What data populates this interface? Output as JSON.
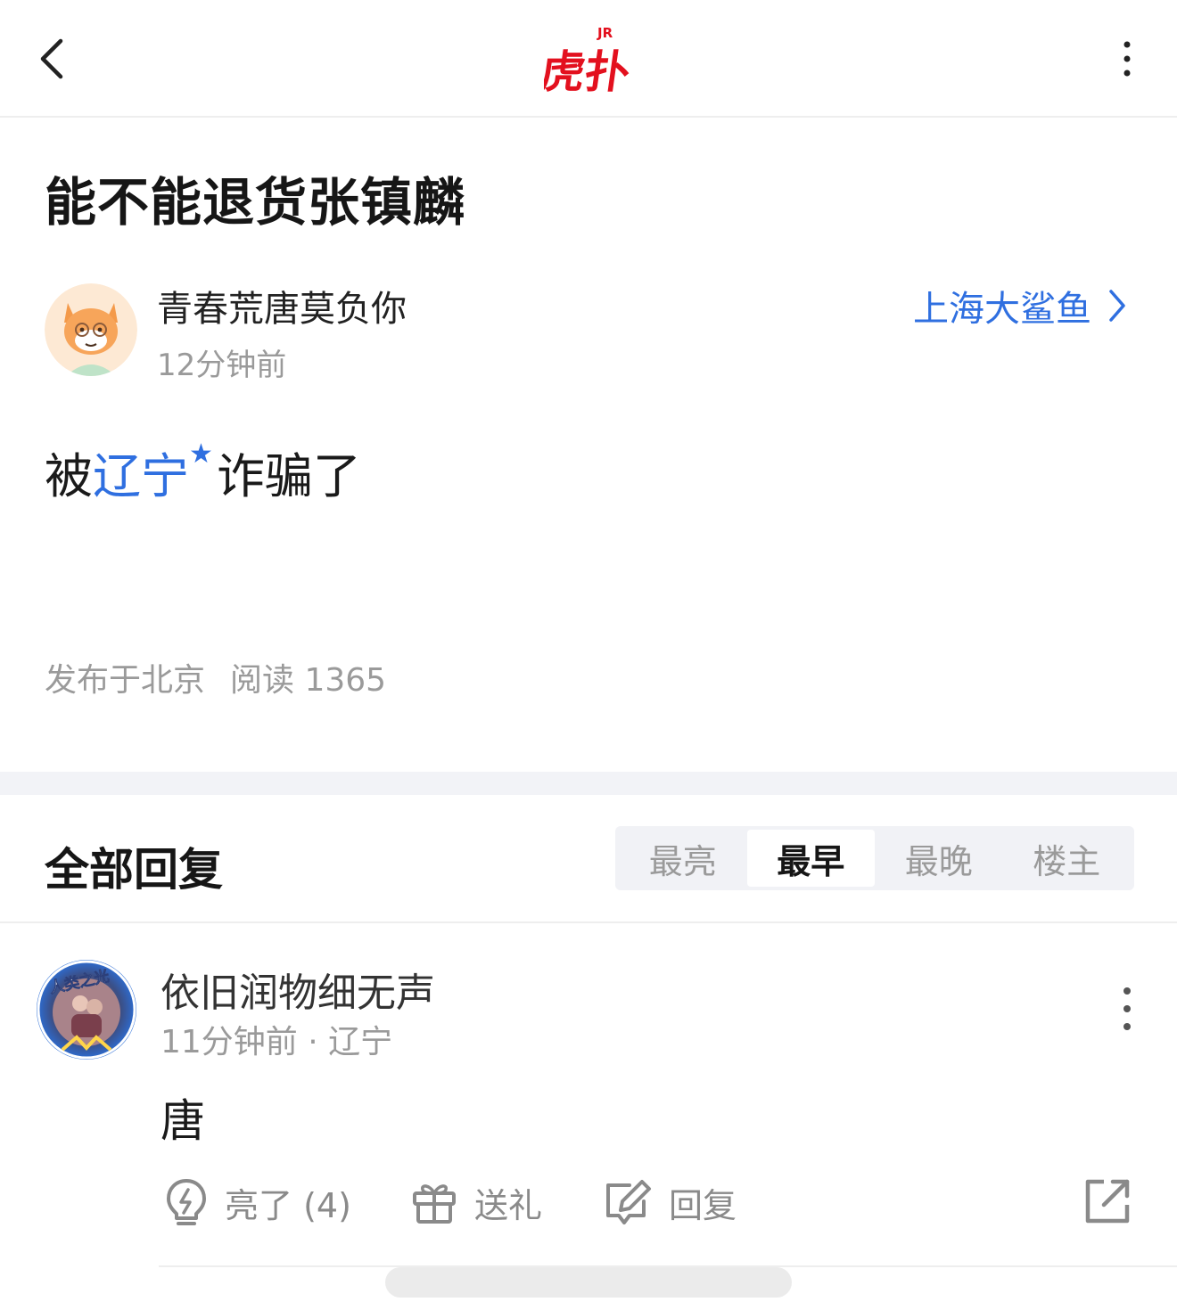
{
  "header": {
    "logo_text": "虎扑",
    "logo_badge": "JR"
  },
  "post": {
    "title": "能不能退货张镇麟",
    "author": {
      "name": "青春荒唐莫负你",
      "time": "12分钟前"
    },
    "board": "上海大鲨鱼",
    "body_prefix": "被",
    "body_tag": "辽宁",
    "body_suffix": "诈骗了",
    "location": "发布于北京",
    "reads": "阅读 1365"
  },
  "replies": {
    "title": "全部回复",
    "sort_tabs": [
      "最亮",
      "最早",
      "最晚",
      "楼主"
    ],
    "active_tab": "最早",
    "items": [
      {
        "avatar_text": "人类之光",
        "name": "依旧润物细无声",
        "meta": "11分钟前 · 辽宁",
        "content": "唐",
        "actions": {
          "like": "亮了 (4)",
          "gift": "送礼",
          "reply": "回复"
        }
      }
    ]
  },
  "colors": {
    "brand_red": "#e3101e",
    "link_blue": "#2f6fe0",
    "muted_gray": "#9a9a9a"
  },
  "icons": [
    "back-icon",
    "more-vertical-icon",
    "chevron-right-icon",
    "lightbulb-icon",
    "gift-icon",
    "edit-icon",
    "share-icon"
  ]
}
